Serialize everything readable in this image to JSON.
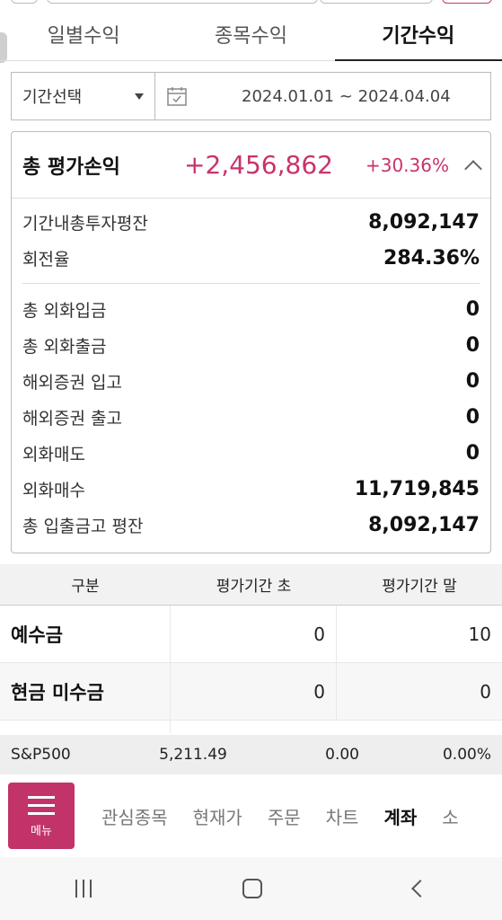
{
  "tabs": [
    {
      "label": "일별수익",
      "active": false
    },
    {
      "label": "종목수익",
      "active": false
    },
    {
      "label": "기간수익",
      "active": true
    }
  ],
  "period": {
    "select_label": "기간선택",
    "date_range": "2024.01.01 ~ 2024.04.04",
    "calendar_icon": "calendar-icon"
  },
  "summary": {
    "title": "총 평가손익",
    "amount": "+2,456,862",
    "percent": "+30.36%",
    "accent_color": "#c8336b",
    "rows_top": [
      {
        "label": "기간내총투자평잔",
        "value": "8,092,147"
      },
      {
        "label": "회전율",
        "value": "284.36%"
      }
    ],
    "rows_bottom": [
      {
        "label": "총 외화입금",
        "value": "0"
      },
      {
        "label": "총 외화출금",
        "value": "0"
      },
      {
        "label": "해외증권 입고",
        "value": "0"
      },
      {
        "label": "해외증권 출고",
        "value": "0"
      },
      {
        "label": "외화매도",
        "value": "0"
      },
      {
        "label": "외화매수",
        "value": "11,719,845"
      },
      {
        "label": "총 입출금고 평잔",
        "value": "8,092,147"
      }
    ]
  },
  "table": {
    "headers": [
      "구분",
      "평가기간 초",
      "평가기간 말"
    ],
    "rows": [
      {
        "label": "예수금",
        "start": "0",
        "end": "10"
      },
      {
        "label": "현금 미수금",
        "start": "0",
        "end": "0"
      }
    ]
  },
  "ticker": {
    "name": "S&P500",
    "price": "5,211.49",
    "change": "0.00",
    "percent": "0.00%"
  },
  "bottom_nav": {
    "menu_label": "메뉴",
    "menu_color": "#c2336a",
    "items": [
      {
        "label": "관심종목",
        "active": false
      },
      {
        "label": "현재가",
        "active": false
      },
      {
        "label": "주문",
        "active": false
      },
      {
        "label": "차트",
        "active": false
      },
      {
        "label": "계좌",
        "active": true
      },
      {
        "label": "소",
        "active": false
      }
    ]
  }
}
